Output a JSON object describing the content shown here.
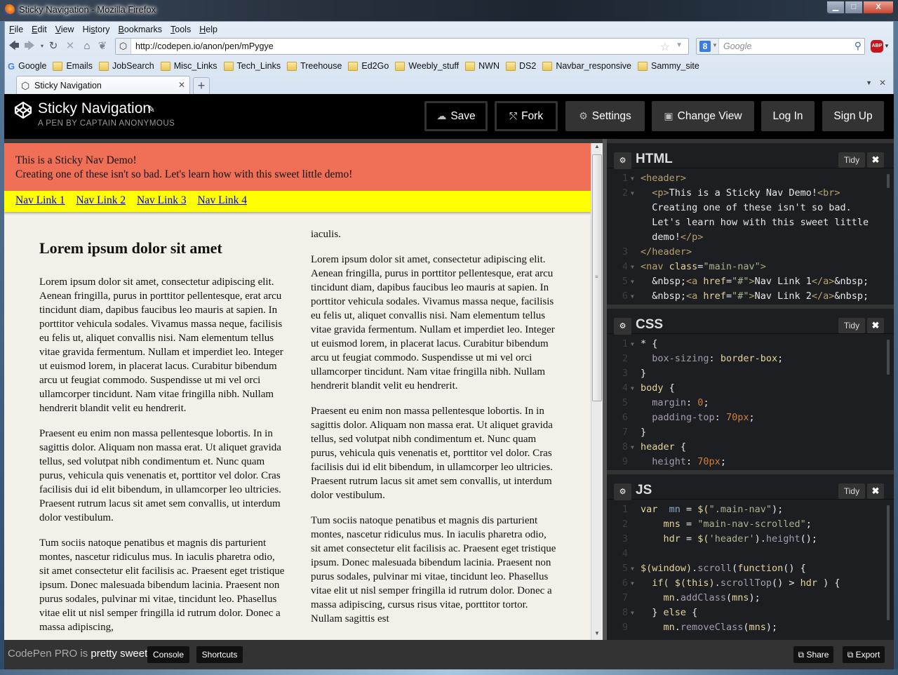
{
  "window": {
    "title": "Sticky Navigation - Mozilla Firefox",
    "controls": {
      "minimize": "▁",
      "maximize": "□",
      "close": "X"
    }
  },
  "menu": [
    "File",
    "Edit",
    "View",
    "History",
    "Bookmarks",
    "Tools",
    "Help"
  ],
  "menu_mnemonic": [
    "F",
    "E",
    "V",
    "s",
    "B",
    "T",
    "H"
  ],
  "navigation": {
    "url": "http://codepen.io/anon/pen/mPygye",
    "search_placeholder": "Google",
    "search_engine_letter": "8",
    "abp_label": "ABP"
  },
  "bookmarks": [
    {
      "label": "Google",
      "icon": "google-icon"
    },
    {
      "label": "Emails",
      "icon": "folder-icon"
    },
    {
      "label": "JobSearch",
      "icon": "folder-icon"
    },
    {
      "label": "Misc_Links",
      "icon": "folder-icon"
    },
    {
      "label": "Tech_Links",
      "icon": "folder-icon"
    },
    {
      "label": "Treehouse",
      "icon": "folder-icon"
    },
    {
      "label": "Ed2Go",
      "icon": "folder-icon"
    },
    {
      "label": "Weebly_stuff",
      "icon": "folder-icon"
    },
    {
      "label": "NWN",
      "icon": "folder-icon"
    },
    {
      "label": "DS2",
      "icon": "folder-icon"
    },
    {
      "label": "Navbar_responsive",
      "icon": "folder-icon"
    },
    {
      "label": "Sammy_site",
      "icon": "folder-icon"
    }
  ],
  "tabs": [
    {
      "label": "Sticky Navigation",
      "active": true
    }
  ],
  "codepen": {
    "pen_title": "Sticky Navigation",
    "pen_subtitle": "A PEN BY CAPTAIN ANONYMOUS",
    "buttons": {
      "save": "Save",
      "fork": "Fork",
      "settings": "Settings",
      "change_view": "Change View",
      "login": "Log In",
      "signup": "Sign Up"
    },
    "footer": {
      "pro_prefix": "CodePen PRO is ",
      "pro_bold": "pretty sweet.",
      "console": "Console",
      "shortcuts": "Shortcuts",
      "share": "Share",
      "export": "Export"
    }
  },
  "preview": {
    "header_line1": "This is a Sticky Nav Demo!",
    "header_line2": "Creating one of these isn't so bad. Let's learn how with this sweet little demo!",
    "nav_links": [
      "Nav Link 1",
      "Nav Link 2",
      "Nav Link 3",
      "Nav Link 4"
    ],
    "colors": {
      "header_bg": "#f07057",
      "nav_bg": "#ffff00",
      "page_bg": "#f2f0e9"
    },
    "col1": {
      "heading": "Lorem ipsum dolor sit amet",
      "paragraphs": [
        "Lorem ipsum dolor sit amet, consectetur adipiscing elit. Aenean fringilla, purus in porttitor pellentesque, erat arcu tincidunt diam, dapibus faucibus leo mauris at sapien. In porttitor vehicula sodales. Vivamus massa neque, facilisis eu felis ut, aliquet convallis nisi. Nam elementum tellus vitae gravida fermentum. Nullam et imperdiet leo. Integer ut euismod lorem, in placerat lacus. Curabitur bibendum arcu ut feugiat commodo. Suspendisse ut mi vel orci ullamcorper tincidunt. Nam vitae fringilla nibh. Nullam hendrerit blandit velit eu hendrerit.",
        "Praesent eu enim non massa pellentesque lobortis. In in sagittis dolor. Aliquam non massa erat. Ut aliquet gravida tellus, sed volutpat nibh condimentum et. Nunc quam purus, vehicula quis venenatis et, porttitor vel dolor. Cras facilisis dui id elit bibendum, in ullamcorper leo ultricies. Praesent rutrum lacus sit amet sem convallis, ut interdum dolor vestibulum.",
        "Tum sociis natoque penatibus et magnis dis parturient montes, nascetur ridiculus mus. In iaculis pharetra odio, sit amet consectetur elit facilisis ac. Praesent eget tristique ipsum. Donec malesuada bibendum lacinia. Praesent non purus sodales, pulvinar mi vitae, tincidunt leo. Phasellus vitae elit ut nisl semper fringilla id rutrum dolor. Donec a massa adipiscing,"
      ]
    },
    "col2": {
      "paragraphs": [
        "iaculis.",
        "Lorem ipsum dolor sit amet, consectetur adipiscing elit. Aenean fringilla, purus in porttitor pellentesque, erat arcu tincidunt diam, dapibus faucibus leo mauris at sapien. In porttitor vehicula sodales. Vivamus massa neque, facilisis eu felis ut, aliquet convallis nisi. Nam elementum tellus vitae gravida fermentum. Nullam et imperdiet leo. Integer ut euismod lorem, in placerat lacus. Curabitur bibendum arcu ut feugiat commodo. Suspendisse ut mi vel orci ullamcorper tincidunt. Nam vitae fringilla nibh. Nullam hendrerit blandit velit eu hendrerit.",
        "Praesent eu enim non massa pellentesque lobortis. In in sagittis dolor. Aliquam non massa erat. Ut aliquet gravida tellus, sed volutpat nibh condimentum et. Nunc quam purus, vehicula quis venenatis et, porttitor vel dolor. Cras facilisis dui id elit bibendum, in ullamcorper leo ultricies. Praesent rutrum lacus sit amet sem convallis, ut interdum dolor vestibulum.",
        "Tum sociis natoque penatibus et magnis dis parturient montes, nascetur ridiculus mus. In iaculis pharetra odio, sit amet consectetur elit facilisis ac. Praesent eget tristique ipsum. Donec malesuada bibendum lacinia. Praesent non purus sodales, pulvinar mi vitae, tincidunt leo. Phasellus vitae elit ut nisl semper fringilla id rutrum dolor. Donec a massa adipiscing, cursus risus vitae, porttitor tortor. Nullam sagittis est"
      ]
    }
  },
  "editors": {
    "html": {
      "title": "HTML",
      "tidy": "Tidy",
      "lines": [
        {
          "n": "1",
          "fold": true,
          "tokens": [
            [
              "c-tag",
              "<header>"
            ]
          ]
        },
        {
          "n": "2",
          "fold": true,
          "wrap": true,
          "tokens": [
            [
              "c-w",
              "  "
            ],
            [
              "c-tag",
              "<p>"
            ],
            [
              "c-w",
              "This is a Sticky Nav Demo!"
            ],
            [
              "c-tag",
              "<br>"
            ],
            [
              "c-w",
              "\n  Creating one of these isn't so bad.\n  Let's learn how with this sweet little\n  demo!"
            ],
            [
              "c-tag",
              "</p>"
            ]
          ]
        },
        {
          "n": "3",
          "fold": false,
          "tokens": [
            [
              "c-tag",
              "</header>"
            ]
          ]
        },
        {
          "n": "4",
          "fold": true,
          "tokens": [
            [
              "c-tag",
              "<nav "
            ],
            [
              "c-attr",
              "class"
            ],
            [
              "c-w",
              "="
            ],
            [
              "c-str",
              "\"main-nav\""
            ],
            [
              "c-tag",
              ">"
            ]
          ]
        },
        {
          "n": "5",
          "fold": true,
          "tokens": [
            [
              "c-w",
              "  &nbsp;"
            ],
            [
              "c-tag",
              "<a "
            ],
            [
              "c-attr",
              "href"
            ],
            [
              "c-w",
              "="
            ],
            [
              "c-str",
              "\"#\""
            ],
            [
              "c-tag",
              ">"
            ],
            [
              "c-w",
              "Nav Link 1"
            ],
            [
              "c-tag",
              "</a>"
            ],
            [
              "c-w",
              "&nbsp;"
            ]
          ]
        },
        {
          "n": "6",
          "fold": true,
          "tokens": [
            [
              "c-w",
              "  &nbsp;"
            ],
            [
              "c-tag",
              "<a "
            ],
            [
              "c-attr",
              "href"
            ],
            [
              "c-w",
              "="
            ],
            [
              "c-str",
              "\"#\""
            ],
            [
              "c-tag",
              ">"
            ],
            [
              "c-w",
              "Nav Link 2"
            ],
            [
              "c-tag",
              "</a>"
            ],
            [
              "c-w",
              "&nbsp;"
            ]
          ]
        }
      ]
    },
    "css": {
      "title": "CSS",
      "tidy": "Tidy",
      "lines": [
        {
          "n": "1",
          "fold": true,
          "tokens": [
            [
              "c-w",
              "* {"
            ]
          ]
        },
        {
          "n": "2",
          "fold": false,
          "tokens": [
            [
              "c-prop",
              "  box-sizing"
            ],
            [
              "c-w",
              ": "
            ],
            [
              "c-val",
              "border-box"
            ],
            [
              "c-w",
              ";"
            ]
          ]
        },
        {
          "n": "3",
          "fold": false,
          "tokens": [
            [
              "c-w",
              "}"
            ]
          ]
        },
        {
          "n": "4",
          "fold": true,
          "tokens": [
            [
              "c-sel",
              "body"
            ],
            [
              "c-w",
              " {"
            ]
          ]
        },
        {
          "n": "5",
          "fold": false,
          "tokens": [
            [
              "c-prop",
              "  margin"
            ],
            [
              "c-w",
              ": "
            ],
            [
              "c-num",
              "0"
            ],
            [
              "c-w",
              ";"
            ]
          ]
        },
        {
          "n": "6",
          "fold": false,
          "tokens": [
            [
              "c-prop",
              "  padding-top"
            ],
            [
              "c-w",
              ": "
            ],
            [
              "c-num",
              "70px"
            ],
            [
              "c-w",
              ";"
            ]
          ]
        },
        {
          "n": "7",
          "fold": false,
          "tokens": [
            [
              "c-w",
              "}"
            ]
          ]
        },
        {
          "n": "8",
          "fold": true,
          "tokens": [
            [
              "c-sel",
              "header"
            ],
            [
              "c-w",
              " {"
            ]
          ]
        },
        {
          "n": "9",
          "fold": false,
          "tokens": [
            [
              "c-prop",
              "  height"
            ],
            [
              "c-w",
              ": "
            ],
            [
              "c-num",
              "70px"
            ],
            [
              "c-w",
              ";"
            ]
          ]
        }
      ]
    },
    "js": {
      "title": "JS",
      "tidy": "Tidy",
      "lines": [
        {
          "n": "1",
          "fold": false,
          "tokens": [
            [
              "c-kw",
              "var  "
            ],
            [
              "c-var",
              "mn"
            ],
            [
              "c-w",
              " = "
            ],
            [
              "c-kw",
              "$("
            ],
            [
              "c-str",
              "\".main-nav\""
            ],
            [
              "c-w",
              ");"
            ]
          ]
        },
        {
          "n": "2",
          "fold": false,
          "tokens": [
            [
              "c-kw",
              "    mns"
            ],
            [
              "c-w",
              " = "
            ],
            [
              "c-str",
              "\"main-nav-scrolled\""
            ],
            [
              "c-w",
              ";"
            ]
          ]
        },
        {
          "n": "3",
          "fold": false,
          "tokens": [
            [
              "c-kw",
              "    hdr"
            ],
            [
              "c-w",
              " = "
            ],
            [
              "c-kw",
              "$("
            ],
            [
              "c-str",
              "'header'"
            ],
            [
              "c-w",
              ")."
            ],
            [
              "c-fn",
              "height"
            ],
            [
              "c-w",
              "();"
            ]
          ]
        },
        {
          "n": "4",
          "fold": false,
          "tokens": [
            [
              "c-w",
              ""
            ]
          ]
        },
        {
          "n": "5",
          "fold": true,
          "tokens": [
            [
              "c-kw",
              "$(window)"
            ],
            [
              "c-w",
              "."
            ],
            [
              "c-fn",
              "scroll"
            ],
            [
              "c-w",
              "("
            ],
            [
              "c-kw",
              "function"
            ],
            [
              "c-w",
              "() {"
            ]
          ]
        },
        {
          "n": "6",
          "fold": true,
          "tokens": [
            [
              "c-kw",
              "  if( $(this)"
            ],
            [
              "c-w",
              "."
            ],
            [
              "c-fn",
              "scrollTop"
            ],
            [
              "c-w",
              "() > "
            ],
            [
              "c-kw",
              "hdr"
            ],
            [
              "c-w",
              " ) {"
            ]
          ]
        },
        {
          "n": "7",
          "fold": false,
          "tokens": [
            [
              "c-kw",
              "    mn"
            ],
            [
              "c-w",
              "."
            ],
            [
              "c-fn",
              "addClass"
            ],
            [
              "c-w",
              "("
            ],
            [
              "c-kw",
              "mns"
            ],
            [
              "c-w",
              ");"
            ]
          ]
        },
        {
          "n": "8",
          "fold": true,
          "tokens": [
            [
              "c-w",
              "  } "
            ],
            [
              "c-kw",
              "else"
            ],
            [
              "c-w",
              " {"
            ]
          ]
        },
        {
          "n": "9",
          "fold": false,
          "tokens": [
            [
              "c-kw",
              "    mn"
            ],
            [
              "c-w",
              "."
            ],
            [
              "c-fn",
              "removeClass"
            ],
            [
              "c-w",
              "("
            ],
            [
              "c-kw",
              "mns"
            ],
            [
              "c-w",
              ");"
            ]
          ]
        }
      ]
    }
  }
}
